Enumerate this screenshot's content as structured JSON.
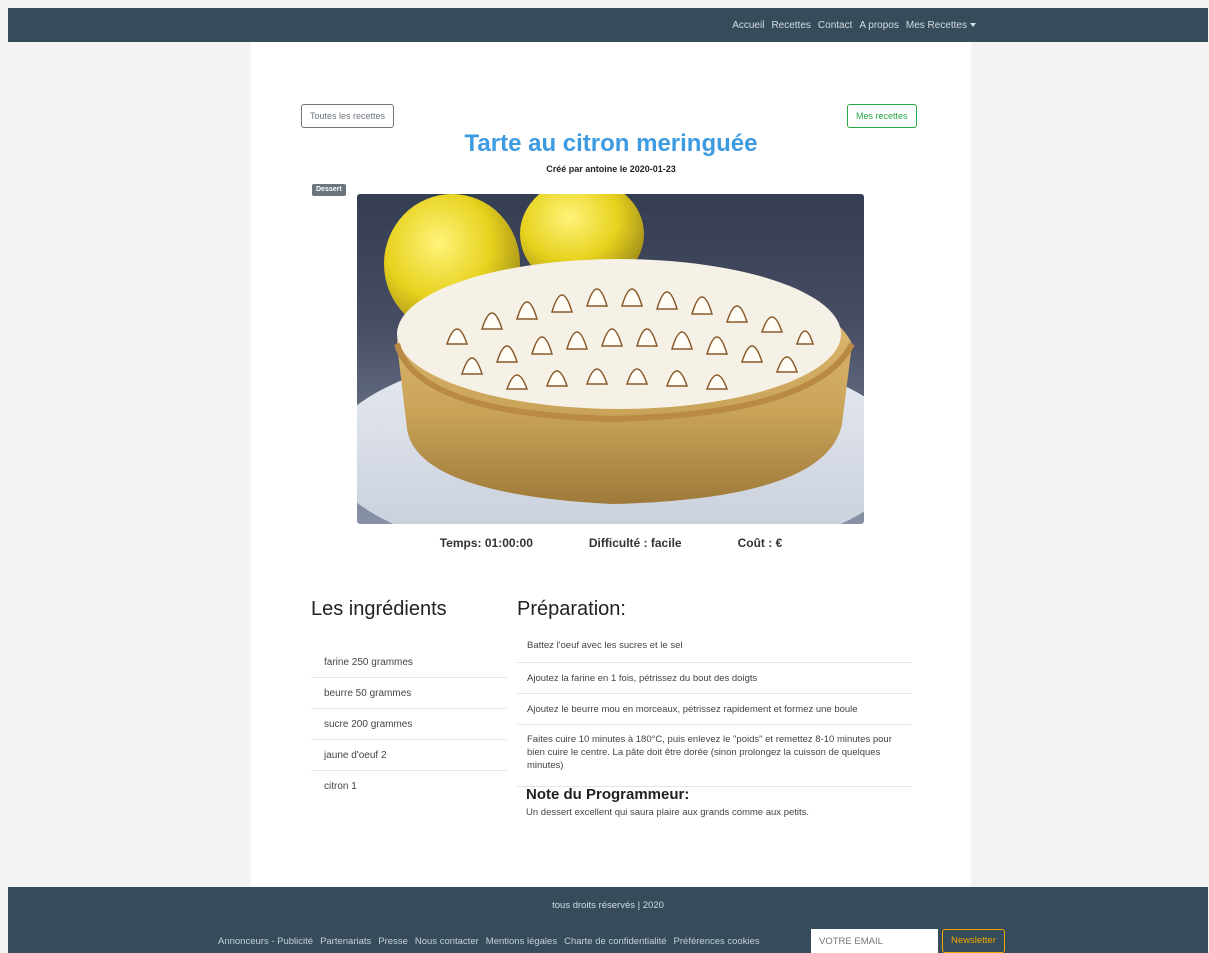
{
  "nav": {
    "links": [
      "Accueil",
      "Recettes",
      "Contact",
      "A propos",
      "Mes Recettes"
    ]
  },
  "buttons": {
    "all_recipes": "Toutes les recettes",
    "my_recipes": "Mes recettes"
  },
  "recipe": {
    "title": "Tarte au citron meringuée",
    "byline": "Créé par antoine le 2020-01-23",
    "category": "Dessert",
    "time": "Temps: 01:00:00",
    "difficulty": "Difficulté : facile",
    "cost": "Coût : €"
  },
  "ingredients": {
    "title": "Les ingrédients",
    "items": [
      "farine 250 grammes",
      "beurre 50 grammes",
      "sucre 200 grammes",
      "jaune d'oeuf 2",
      "citron 1"
    ]
  },
  "preparation": {
    "title": "Préparation:",
    "steps": [
      "Battez l'oeuf avec les sucres et le sel",
      "Ajoutez la farine en 1 fois, pétrissez du bout des doigts",
      "Ajoutez le beurre mou en morceaux, pétrissez rapidement et formez une boule",
      "Faites cuire 10 minutes à 180°C, puis enlevez le \"poids\" et remettez 8-10 minutes pour bien cuire le centre. La pâte doit être dorée (sinon prolongez la cuisson de quelques minutes)"
    ]
  },
  "note": {
    "title": "Note du Programmeur:",
    "text": "Un dessert excellent qui saura plaire aux grands comme aux petits."
  },
  "footer": {
    "rights": "tous droits réservés | 2020",
    "links": [
      "Annonceurs - Publicité",
      "Partenariats",
      "Presse",
      "Nous contacter",
      "Mentions légales",
      "Charte de confidentialité",
      "Préférences cookies"
    ],
    "email_placeholder": "VOTRE EMAIL",
    "newsletter": "Newsletter"
  },
  "colors": {
    "navbar": "#364c5a",
    "title": "#3d9be0",
    "btn_secondary": "#6c757d",
    "btn_success": "#28a745",
    "btn_warning": "#f0a500"
  }
}
